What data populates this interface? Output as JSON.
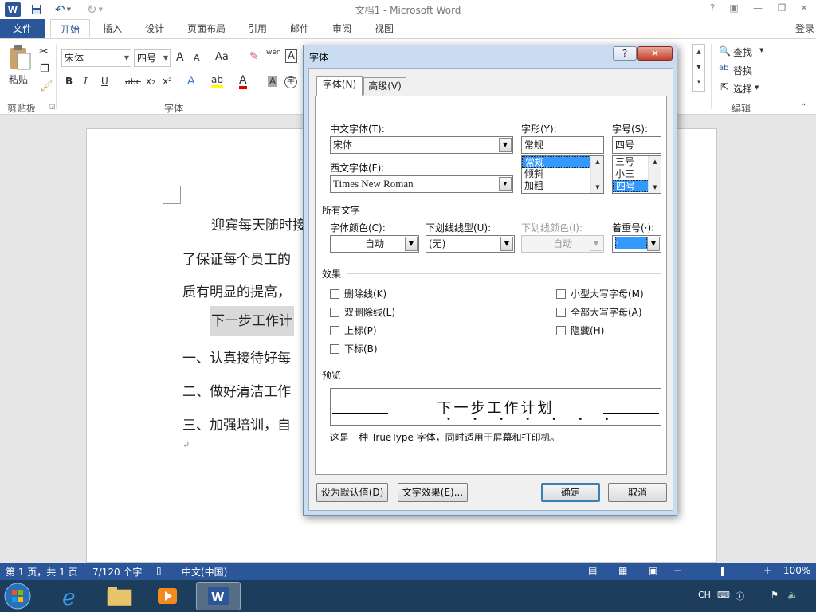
{
  "titlebar": {
    "title": "文档1 - Microsoft Word",
    "word_icon": "W",
    "help": "?",
    "ribbon_display": "▣",
    "minimize": "—",
    "restore": "❐",
    "close": "✕"
  },
  "tabs": {
    "file": "文件",
    "items": [
      "开始",
      "插入",
      "设计",
      "页面布局",
      "引用",
      "邮件",
      "审阅",
      "视图"
    ],
    "login": "登录"
  },
  "ribbon": {
    "clipboard": {
      "paste": "粘贴",
      "group": "剪贴板"
    },
    "font": {
      "font_name": "宋体",
      "font_size": "四号",
      "grow": "A",
      "shrink": "A",
      "case": "Aa",
      "clear": "✎",
      "phonetic": "wén",
      "border_char": "A",
      "bold": "B",
      "italic": "I",
      "underline": "U",
      "strike": "abc",
      "subscript": "x₂",
      "superscript": "x²",
      "text_effect": "A",
      "highlight": "ab",
      "font_color": "A",
      "shade": "A",
      "enclose": "字",
      "group": "字体"
    },
    "editing": {
      "find": "查找",
      "replace": "替换",
      "select": "选择",
      "group": "编辑"
    }
  },
  "document": {
    "lines": [
      "迎宾每天随时接",
      "了保证每个员工的",
      "质有明显的提高，",
      "下一步工作计",
      "一、认真接待好每",
      "二、做好清洁工作",
      "三、加强培训，自"
    ],
    "para_mark": "↵"
  },
  "statusbar": {
    "page": "第 1 页，共 1 页",
    "words": "7/120 个字",
    "language": "中文(中国)",
    "zoom": "100%",
    "zoom_level": 1.0
  },
  "taskbar": {
    "ime": "CH",
    "tray_icons": [
      "keyboard-icon",
      "help-icon",
      "flag-icon",
      "volume-icon"
    ]
  },
  "dialog": {
    "title": "字体",
    "help": "?",
    "close": "✕",
    "tabs": [
      "字体(N)",
      "高级(V)"
    ],
    "labels": {
      "cn_font": "中文字体(T):",
      "west_font": "西文字体(F):",
      "style": "字形(Y):",
      "size": "字号(S):",
      "all_text": "所有文字",
      "font_color": "字体颜色(C):",
      "underline_type": "下划线线型(U):",
      "underline_color": "下划线颜色(I):",
      "emphasis": "着重号(·):",
      "effects": "效果",
      "preview": "预览"
    },
    "values": {
      "cn_font": "宋体",
      "west_font": "Times New Roman",
      "style": "常规",
      "size": "四号",
      "font_color": "自动",
      "underline_type": "(无)",
      "underline_color": "自动",
      "emphasis": "·"
    },
    "style_list": [
      "常规",
      "倾斜",
      "加粗"
    ],
    "style_selected": 0,
    "size_list": [
      "三号",
      "小三",
      "四号"
    ],
    "size_selected": 2,
    "effects_left": [
      "删除线(K)",
      "双删除线(L)",
      "上标(P)",
      "下标(B)"
    ],
    "effects_right": [
      "小型大写字母(M)",
      "全部大写字母(A)",
      "隐藏(H)"
    ],
    "preview_text": "下一步工作计划",
    "preview_dots": "• • • • • • •",
    "note": "这是一种 TrueType 字体，同时适用于屏幕和打印机。",
    "buttons": {
      "set_default": "设为默认值(D)",
      "text_effects": "文字效果(E)...",
      "ok": "确定",
      "cancel": "取消"
    }
  }
}
